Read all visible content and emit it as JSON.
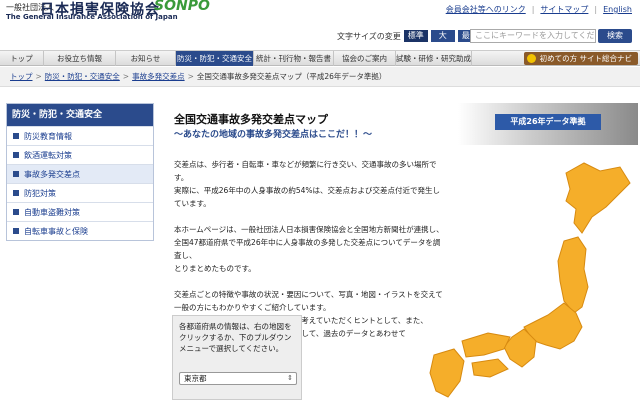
{
  "header": {
    "org_small": "一般社団法人",
    "org_name": "日本損害保険協会",
    "org_en": "The General Insurance Association of Japan",
    "brand": "SONPO",
    "top_links": [
      "会員会社等へのリンク",
      "サイトマップ",
      "English"
    ],
    "font_size_label": "文字サイズの変更",
    "font_size_options": [
      "標準",
      "大",
      "最大"
    ],
    "search_placeholder": "ここにキーワードを入力してくだ",
    "search_button": "検索"
  },
  "nav": {
    "items": [
      "トップ",
      "お役立ち情報",
      "お知らせ",
      "防災・防犯・交通安全",
      "統計・刊行物・報告書",
      "協会のご案内",
      "試験・研修・研究助成"
    ],
    "first_visit": "初めての方 サイト総合ナビ"
  },
  "breadcrumb": [
    "トップ",
    "防災・防犯・交通安全",
    "事故多発交差点",
    "全国交通事故多発交差点マップ（平成26年データ準拠）"
  ],
  "sidebar": {
    "title": "防災・防犯・交通安全",
    "items": [
      "防災教育情報",
      "飲酒運転対策",
      "事故多発交差点",
      "防犯対策",
      "自動車盗難対策",
      "自転車事故と保険"
    ]
  },
  "main": {
    "title": "全国交通事故多発交差点マップ",
    "subtitle": "～あなたの地域の事故多発交差点はここだ！！～",
    "badge": "平成26年データ準拠",
    "paragraphs": [
      "交差点は、歩行者・自転車・車などが頻繁に行き交い、交通事故の多い場所です。\n実際に、平成26年中の人身事故の約54%は、交差点および交差点付近で発生しています。",
      "本ホームページは、一般社団法人日本損害保険協会と全国地方新聞社が連携し、\n全国47都道府県で平成26年中に人身事故の多発した交差点についてデータを調査し、\nとりまとめたものです。",
      "交差点ごとの特徴や事故の状況・要因について、写真・地図・イラストを交えて\n一般の方にもわかりやすくご紹介しています。\n交通事故の低減について多くの皆様に考えていただくヒントとして、また、\n交差点の見直し時などの検討用資料として、過去のデータとあわせて\n幅広くご活用ください。"
    ],
    "prefecture_instruction": "各都道府県の情報は、右の地図をクリックするか、下のプルダウンメニューで選択してください。",
    "prefecture_selected": "東京都"
  },
  "colors": {
    "brand_blue": "#2b4b8c",
    "map_fill": "#f5ae2a",
    "map_stroke": "#d78a10"
  }
}
